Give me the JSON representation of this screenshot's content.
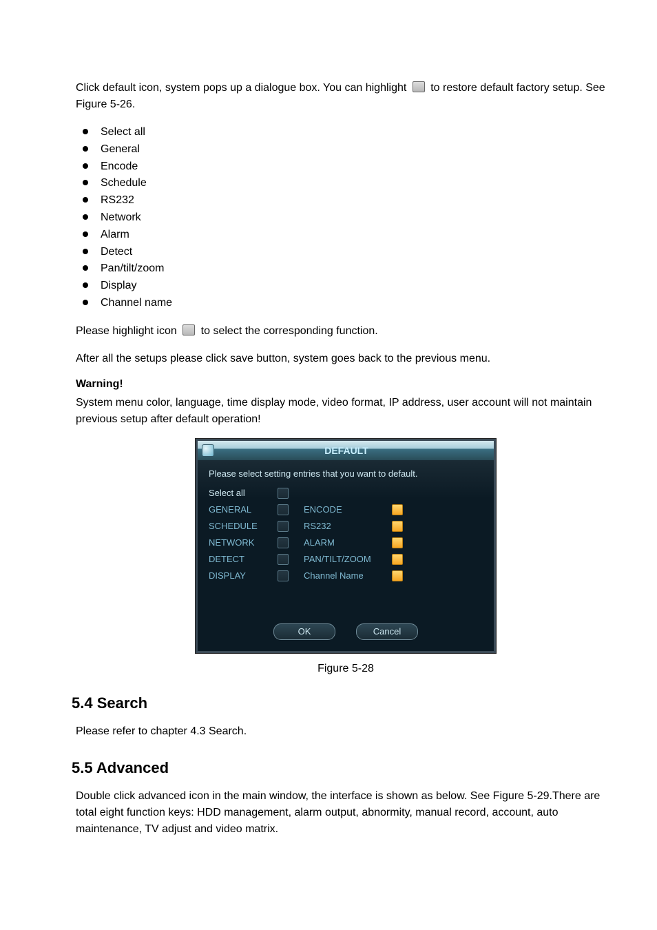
{
  "para1_before": "Click default icon, system pops up a dialogue box. You can highlight ",
  "para1_after": " to restore default factory setup. See Figure 5-26.",
  "bullets": {
    "b0": "Select all",
    "b1": "General",
    "b2": "Encode",
    "b3": "Schedule",
    "b4": "RS232",
    "b5": "Network",
    "b6": "Alarm",
    "b7": "Detect",
    "b8": "Pan/tilt/zoom",
    "b9": "Display",
    "b10": "Channel name"
  },
  "para2_before": "Please highlight icon ",
  "para2_after": " to select the corresponding function.",
  "para3": "After all the setups please click save button, system goes back to the previous menu.",
  "warning_hd": "Warning!",
  "warning_body": "System menu color, language, time display mode, video format, IP address, user account will not maintain previous setup after default operation!",
  "dialog": {
    "title": "DEFAULT",
    "instruction": "Please select setting entries that you want to default.",
    "left": {
      "l0": "Select all",
      "l1": "GENERAL",
      "l2": "SCHEDULE",
      "l3": "NETWORK",
      "l4": "DETECT",
      "l5": "DISPLAY"
    },
    "right": {
      "r0": "ENCODE",
      "r1": "RS232",
      "r2": "ALARM",
      "r3": "PAN/TILT/ZOOM",
      "r4": "Channel Name"
    },
    "ok_label": "OK",
    "cancel_label": "Cancel"
  },
  "figure_caption": "Figure 5-28",
  "section_search": "5.4   Search",
  "search_body": "Please refer to chapter 4.3 Search.",
  "section_advanced": "5.5   Advanced",
  "advanced_body": "Double click advanced icon in the main window, the interface is shown as below. See Figure 5-29.There are total eight function keys: HDD management, alarm output, abnormity, manual record, account, auto maintenance, TV adjust and video matrix."
}
